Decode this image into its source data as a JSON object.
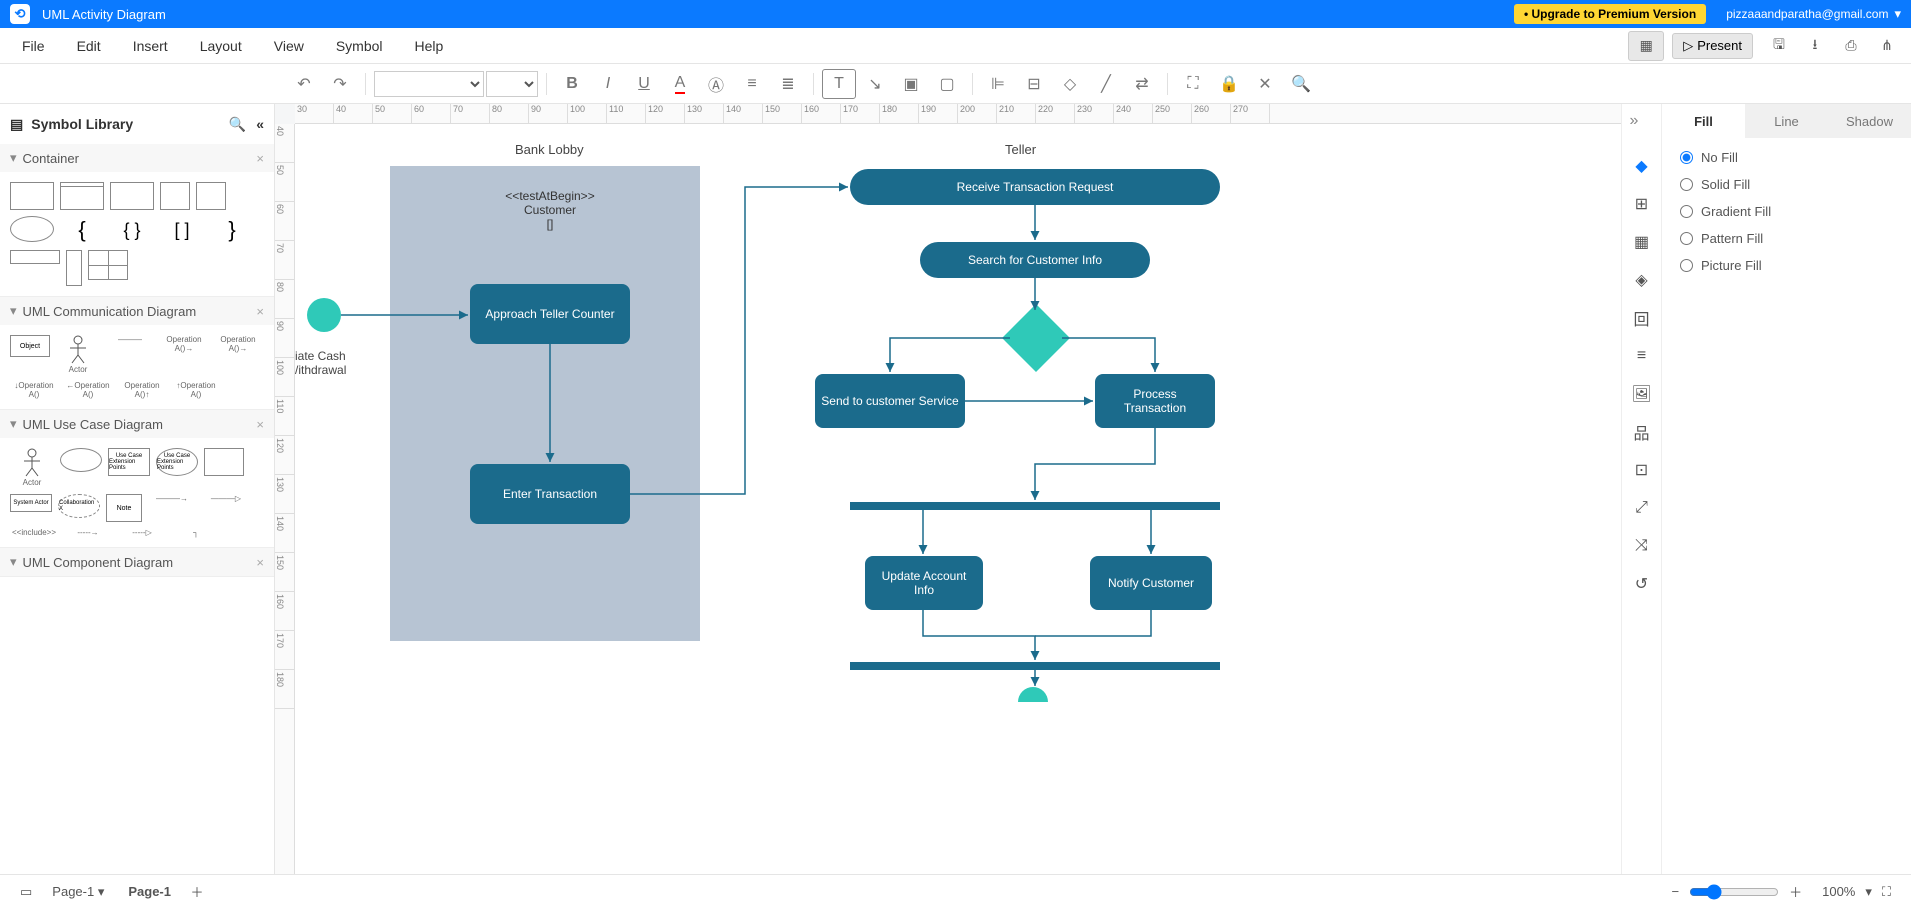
{
  "title": "UML Activity Diagram",
  "upgrade_label": "• Upgrade to Premium Version",
  "user_email": "pizzaaandparatha@gmail.com",
  "menu": {
    "items": [
      "File",
      "Edit",
      "Insert",
      "Layout",
      "View",
      "Symbol",
      "Help"
    ],
    "present": "Present"
  },
  "sidebar": {
    "title": "Symbol Library",
    "sections": [
      {
        "title": "Container"
      },
      {
        "title": "UML Communication Diagram"
      },
      {
        "title": "UML Use Case Diagram"
      },
      {
        "title": "UML Component Diagram"
      }
    ],
    "labels": {
      "actor": "Actor",
      "object": "Object",
      "operation": "Operation A()",
      "usecase": "Use Case",
      "extpoints": "Extension Points",
      "system": "System Actor",
      "collab": "Collaboration X",
      "note": "Note",
      "include": "<<include>>"
    }
  },
  "canvas": {
    "ruler_h": [
      "30",
      "40",
      "50",
      "60",
      "70",
      "80",
      "90",
      "100",
      "110",
      "120",
      "130",
      "140",
      "150",
      "160",
      "170",
      "180",
      "190",
      "200",
      "210",
      "220",
      "230",
      "240",
      "250",
      "260",
      "270"
    ],
    "ruler_v": [
      "40",
      "50",
      "60",
      "70",
      "80",
      "90",
      "100",
      "110",
      "120",
      "130",
      "140",
      "150",
      "160",
      "170",
      "180"
    ],
    "swimlanes": {
      "bank_lobby": "Bank Lobby",
      "teller": "Teller"
    },
    "customer_block": {
      "line1": "<<testAtBegin>>",
      "line2": "Customer",
      "line3": "[]"
    },
    "partial_label": {
      "line1": "iate Cash",
      "line2": "/ithdrawal"
    },
    "activities": {
      "approach": "Approach Teller Counter",
      "enter": "Enter Transaction",
      "receive": "Receive Transaction Request",
      "search": "Search for Customer Info",
      "send": "Send to customer Service",
      "process": "Process Transaction",
      "update": "Update Account Info",
      "notify": "Notify Customer"
    }
  },
  "right_panel": {
    "tabs": [
      "Fill",
      "Line",
      "Shadow"
    ],
    "options": [
      "No Fill",
      "Solid Fill",
      "Gradient Fill",
      "Pattern Fill",
      "Picture Fill"
    ]
  },
  "statusbar": {
    "page_dropdown": "Page-1",
    "page_tab": "Page-1",
    "zoom": "100%"
  }
}
